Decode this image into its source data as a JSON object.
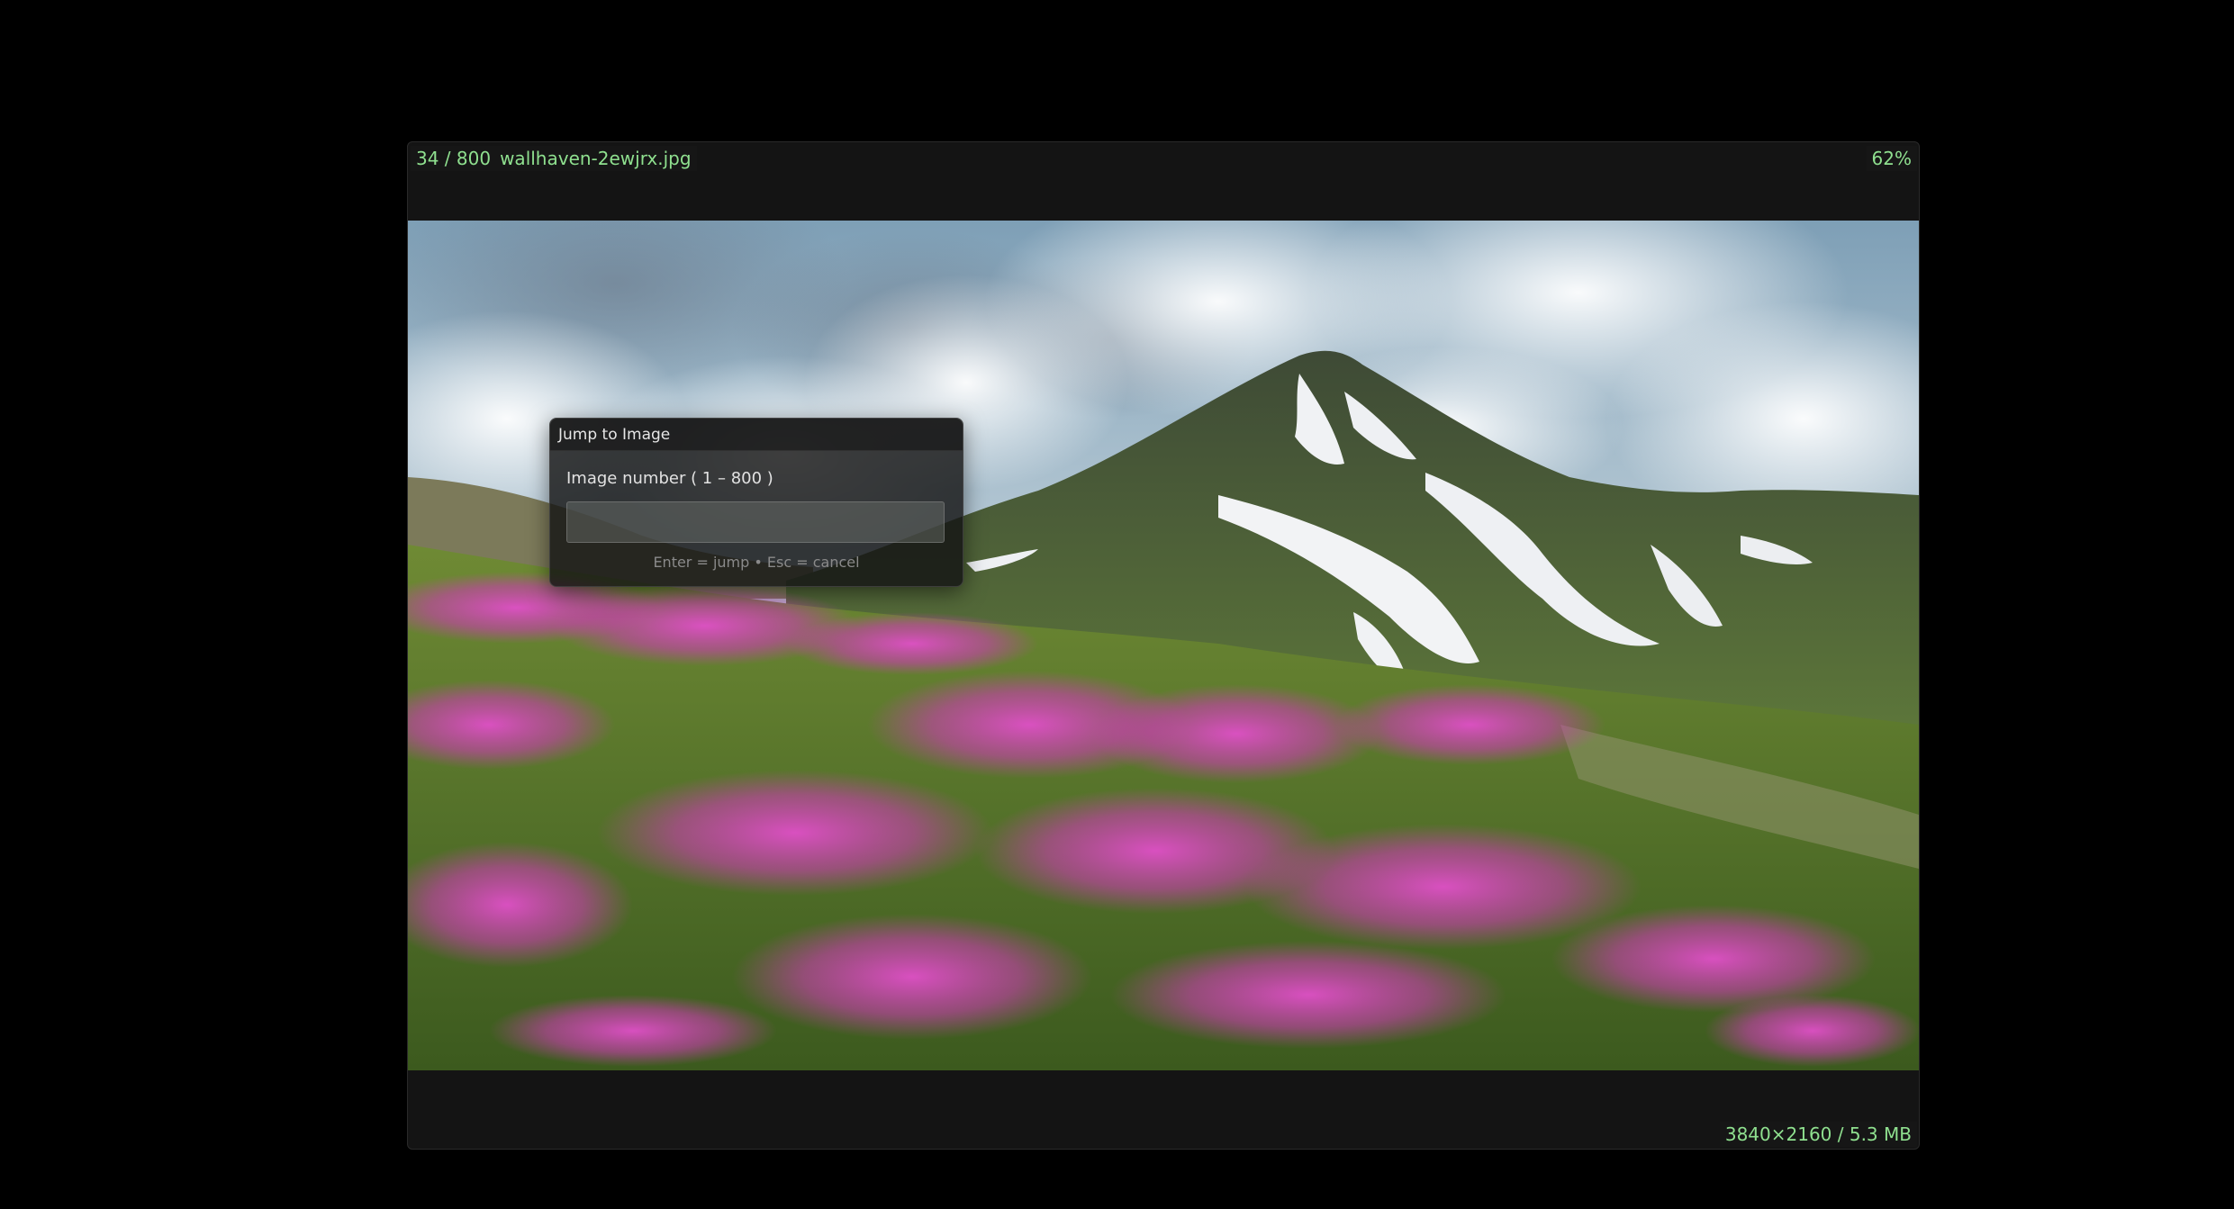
{
  "viewer": {
    "position": "34 / 800",
    "filename": "wallhaven-2ewjrx.jpg",
    "zoom": "62%",
    "image_info": "3840×2160 / 5.3 MB"
  },
  "jump_dialog": {
    "title": "Jump to Image",
    "label": "Image number  ( 1 – 800 )",
    "input_value": "",
    "hint": "Enter = jump  •  Esc = cancel"
  },
  "colors": {
    "background": "#000000",
    "panel": "#141414",
    "overlay_text": "#8fe08f",
    "flower_pink": "#d94bc3"
  }
}
